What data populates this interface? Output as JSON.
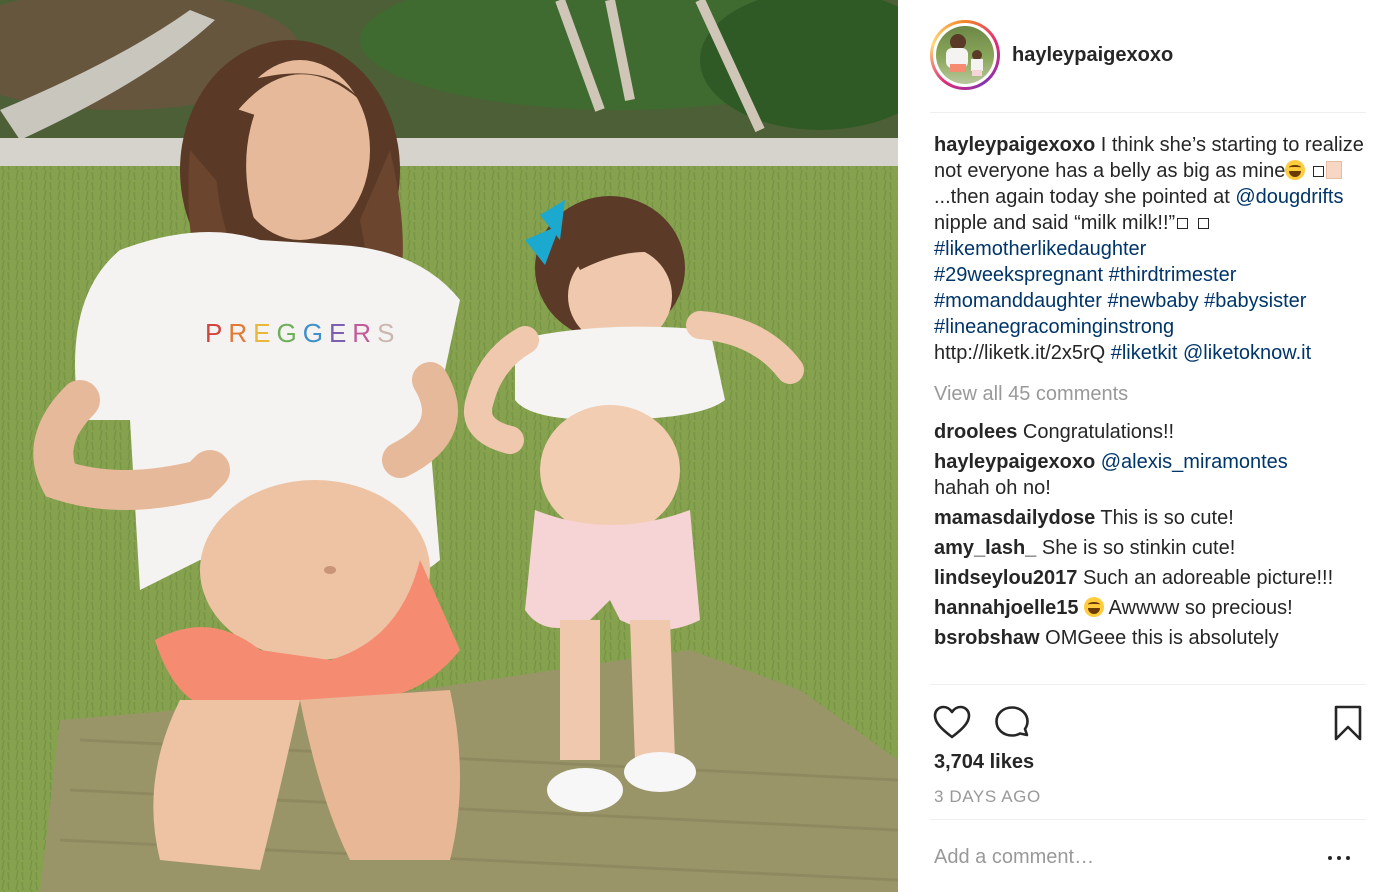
{
  "post": {
    "username": "hayleypaigexoxo",
    "caption": {
      "author": "hayleypaigexoxo",
      "text_1": " I think she’s starting to realize not everyone has a belly as big as mine",
      "text_2": " ...then again today she pointed at ",
      "mention_1": "@dougdrifts",
      "text_3": " nipple and said “milk milk!!”",
      "hashtags_1": "#likemotherlikedaughter",
      "hashtags_2": "#29weekspregnant #thirdtrimester",
      "hashtags_3": "#momanddaughter #newbaby #babysister",
      "hashtags_4": "#lineanegracominginstrong",
      "link_text": "http://liketk.it/2x5rQ",
      "tag_end": "#liketkit",
      "mention_2": "@liketoknow.it"
    },
    "view_all_comments": "View all 45 comments",
    "comments": [
      {
        "user": "droolees",
        "text": " Congratulations!!"
      },
      {
        "user": "hayleypaigexoxo",
        "mention": "@alexis_miramontes",
        "text": "hahah oh no!"
      },
      {
        "user": "mamasdailydose",
        "text": " This is so cute!"
      },
      {
        "user": "amy_lash_",
        "text": " She is so stinkin cute!"
      },
      {
        "user": "lindseylou2017",
        "text": " Such an adoreable picture!!!"
      },
      {
        "user": "hannahjoelle15",
        "text": " Awwww so precious!"
      },
      {
        "user": "bsrobshaw",
        "text": " OMGeee this is absolutely"
      }
    ],
    "likes": "3,704 likes",
    "time_ago": "3 DAYS AGO",
    "add_comment_placeholder": "Add a comment…",
    "icons": {
      "like": "heart-icon",
      "comment": "speech-bubble-icon",
      "save": "bookmark-icon",
      "more": "ellipsis-icon"
    },
    "photo_shirt_text": "PREGGERS",
    "colors": {
      "link": "#003569",
      "muted": "#999999",
      "text": "#262626",
      "divider": "#efefef"
    }
  }
}
